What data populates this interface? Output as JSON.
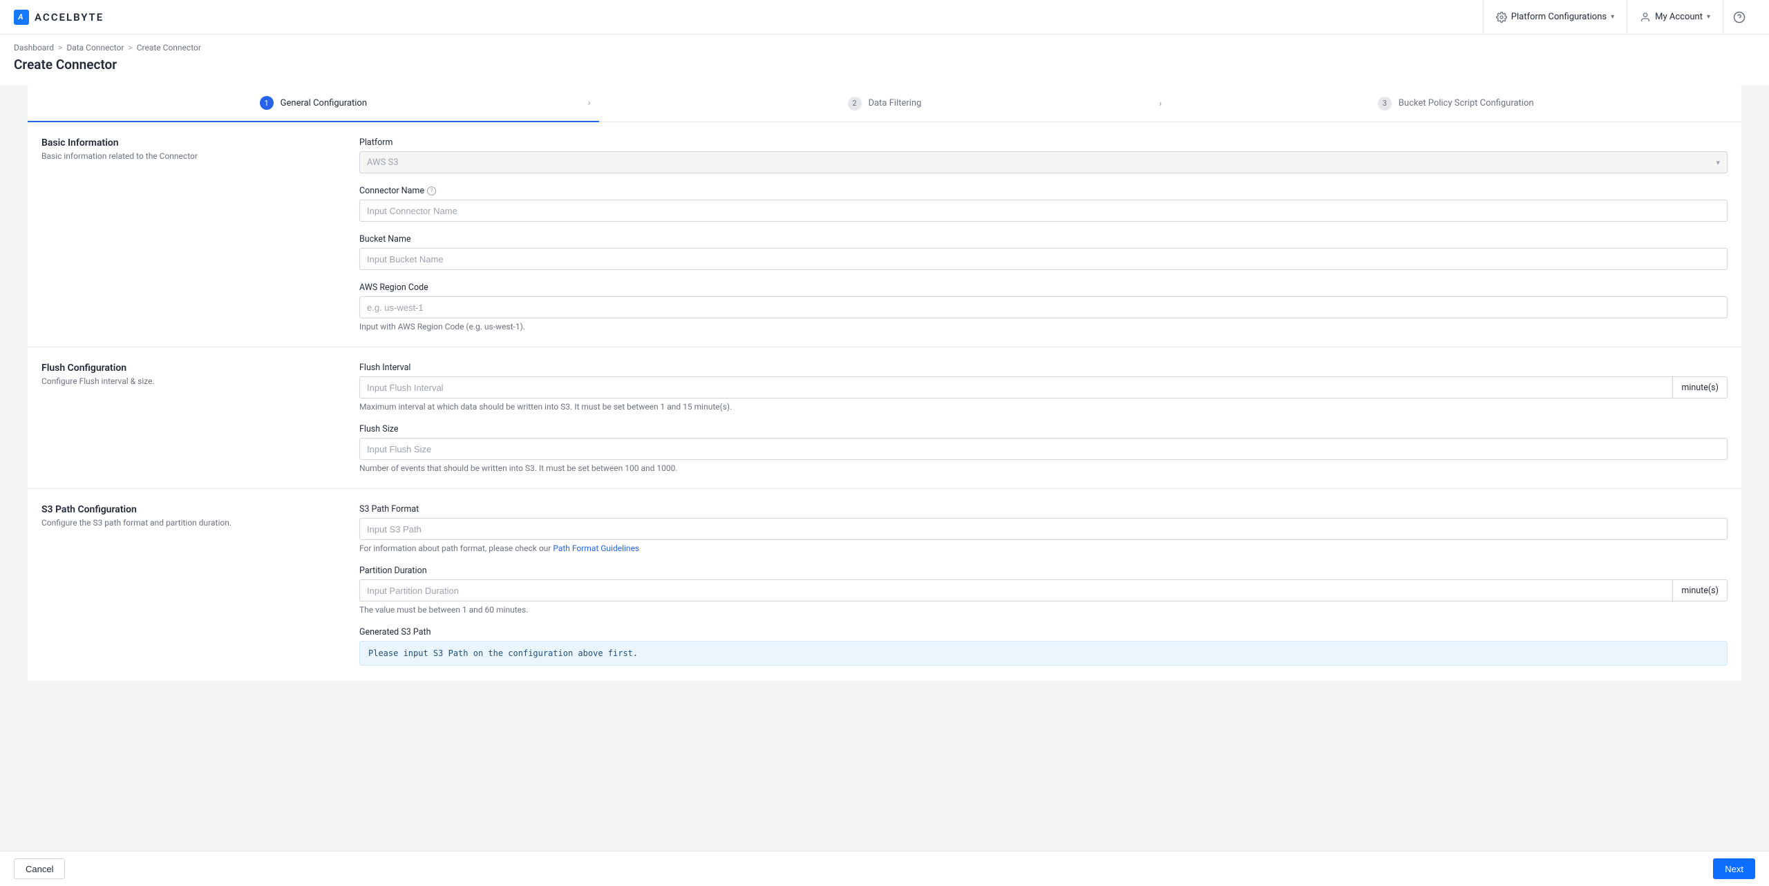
{
  "brand": {
    "name": "ACCELBYTE"
  },
  "topbar": {
    "platform_config": "Platform Configurations",
    "my_account": "My Account"
  },
  "breadcrumbs": {
    "items": [
      "Dashboard",
      "Data Connector",
      "Create Connector"
    ]
  },
  "page_title": "Create Connector",
  "stepper": {
    "steps": [
      {
        "num": "1",
        "label": "General Configuration"
      },
      {
        "num": "2",
        "label": "Data Filtering"
      },
      {
        "num": "3",
        "label": "Bucket Policy Script Configuration"
      }
    ]
  },
  "sections": {
    "basic": {
      "title": "Basic Information",
      "desc": "Basic information related to the Connector",
      "platform_label": "Platform",
      "platform_value": "AWS S3",
      "connector_name_label": "Connector Name",
      "connector_name_placeholder": "Input Connector Name",
      "bucket_name_label": "Bucket Name",
      "bucket_name_placeholder": "Input Bucket Name",
      "aws_region_label": "AWS Region Code",
      "aws_region_placeholder": "e.g. us-west-1",
      "aws_region_hint": "Input with AWS Region Code (e.g. us-west-1)."
    },
    "flush": {
      "title": "Flush Configuration",
      "desc": "Configure Flush interval & size.",
      "interval_label": "Flush Interval",
      "interval_placeholder": "Input Flush Interval",
      "interval_suffix": "minute(s)",
      "interval_hint": "Maximum interval at which data should be written into S3. It must be set between 1 and 15 minute(s).",
      "size_label": "Flush Size",
      "size_placeholder": "Input Flush Size",
      "size_hint": "Number of events that should be written into S3. It must be set between 100 and 1000."
    },
    "s3path": {
      "title": "S3 Path Configuration",
      "desc": "Configure the S3 path format and partition duration.",
      "path_format_label": "S3 Path Format",
      "path_format_placeholder": "Input S3 Path",
      "path_format_hint_prefix": "For information about path format, please check our ",
      "path_format_link": "Path Format Guidelines",
      "partition_label": "Partition Duration",
      "partition_placeholder": "Input Partition Duration",
      "partition_suffix": "minute(s)",
      "partition_hint": "The value must be between 1 and 60 minutes.",
      "generated_label": "Generated S3 Path",
      "generated_value": "Please input S3 Path on the configuration above first."
    }
  },
  "footer": {
    "cancel": "Cancel",
    "next": "Next"
  }
}
